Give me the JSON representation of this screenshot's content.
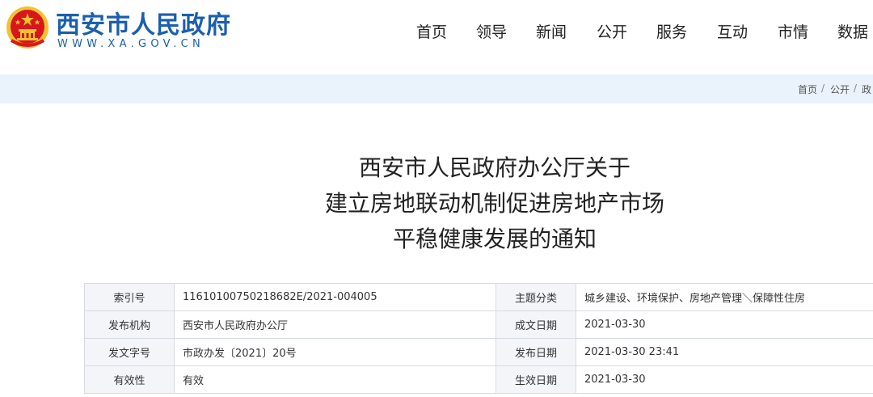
{
  "site": {
    "title": "西安市人民政府",
    "url": "WWW.XA.GOV.CN"
  },
  "nav": {
    "items": [
      "首页",
      "领导",
      "新闻",
      "公开",
      "服务",
      "互动",
      "市情",
      "数据"
    ]
  },
  "breadcrumb": {
    "items": [
      "首页",
      "公开",
      "政"
    ]
  },
  "article": {
    "title_lines": [
      "西安市人民政府办公厅关于",
      "建立房地联动机制促进房地产市场",
      "平稳健康发展的通知"
    ]
  },
  "meta": {
    "rows": [
      {
        "k1": "索引号",
        "v1": "11610100750218682E/2021-004005",
        "k2": "主题分类",
        "v2": "城乡建设、环境保护、房地产管理＼保障性住房"
      },
      {
        "k1": "发布机构",
        "v1": "西安市人民政府办公厅",
        "k2": "成文日期",
        "v2": "2021-03-30"
      },
      {
        "k1": "发文字号",
        "v1": "市政办发〔2021〕20号",
        "k2": "发布日期",
        "v2": "2021-03-30 23:41"
      },
      {
        "k1": "有效性",
        "v1": "有效",
        "k2": "生效日期",
        "v2": "2021-03-30"
      }
    ]
  },
  "colors": {
    "brand": "#1b5fae",
    "emblem_red": "#d7161d",
    "emblem_gold": "#f2c230",
    "crumb_bg": "#eaf2fb"
  },
  "icons": [
    "national-emblem-icon"
  ]
}
